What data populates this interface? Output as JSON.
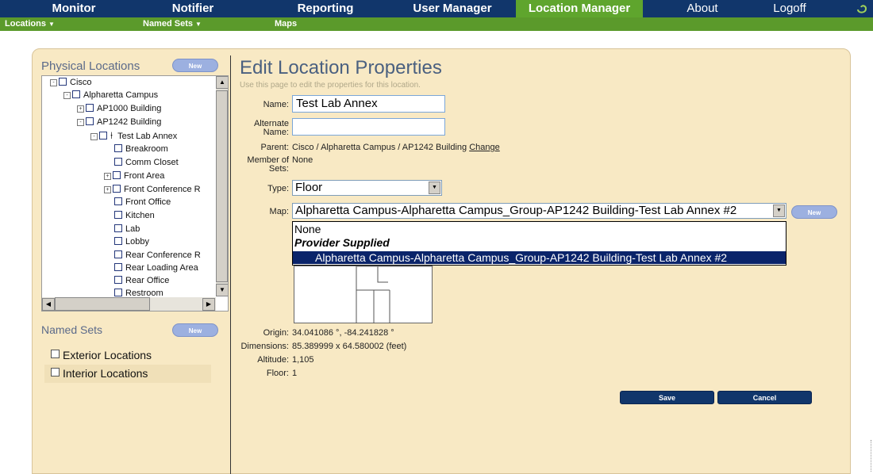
{
  "top_nav": [
    {
      "label": "Monitor"
    },
    {
      "label": "Notifier"
    },
    {
      "label": "Reporting"
    },
    {
      "label": "User Manager"
    },
    {
      "label": "Location Manager",
      "active": true
    },
    {
      "label": "About"
    },
    {
      "label": "Logoff"
    }
  ],
  "sub_nav": [
    {
      "label": "Locations",
      "dropdown": true
    },
    {
      "label": "Named Sets",
      "dropdown": true
    },
    {
      "label": "Maps",
      "dropdown": false
    }
  ],
  "sidebar": {
    "physical_title": "Physical Locations",
    "new_label": "New",
    "tree": [
      {
        "label": "Cisco",
        "expander": "-"
      },
      {
        "label": "Alpharetta Campus",
        "expander": "-"
      },
      {
        "label": "AP1000 Building",
        "expander": "+"
      },
      {
        "label": "AP1242 Building",
        "expander": "-"
      },
      {
        "label": "Test Lab Annex",
        "expander": "-",
        "icon": "location-pin-icon"
      },
      {
        "label": "Breakroom"
      },
      {
        "label": "Comm Closet"
      },
      {
        "label": "Front Area",
        "expander": "+"
      },
      {
        "label": "Front Conference R",
        "expander": "+"
      },
      {
        "label": "Front Office"
      },
      {
        "label": "Kitchen"
      },
      {
        "label": "Lab"
      },
      {
        "label": "Lobby"
      },
      {
        "label": "Rear Conference R"
      },
      {
        "label": "Rear Loading Area"
      },
      {
        "label": "Rear Office"
      },
      {
        "label": "Restroom"
      }
    ],
    "named_sets_title": "Named Sets",
    "named_sets_new_label": "New",
    "named_sets": [
      {
        "label": "Exterior Locations"
      },
      {
        "label": "Interior Locations"
      }
    ]
  },
  "main": {
    "title": "Edit Location Properties",
    "subtitle": "Use this page to edit the properties for this location.",
    "name_label": "Name:",
    "name_value": "Test Lab Annex",
    "alt_name_label_1": "Alternate",
    "alt_name_label_2": "Name:",
    "alt_name_value": "",
    "parent_label": "Parent:",
    "parent_value": "Cisco / Alpharetta Campus / AP1242 Building",
    "parent_change": "Change",
    "member_label_1": "Member of",
    "member_label_2": "Sets:",
    "member_value": "None",
    "type_label": "Type:",
    "type_value": "Floor",
    "map_label": "Map:",
    "map_value": "Alpharetta Campus-Alpharetta Campus_Group-AP1242 Building-Test Lab Annex #2",
    "map_new_label": "New",
    "map_options": [
      {
        "label": "None"
      },
      {
        "label": "Provider Supplied"
      },
      {
        "label": "Alpharetta Campus-Alpharetta Campus_Group-AP1242 Building-Test Lab Annex #2",
        "selected": true
      }
    ],
    "origin_label": "Origin:",
    "origin_value": "34.041086 °, -84.241828 °",
    "dimensions_label": "Dimensions:",
    "dimensions_value": "85.389999 x 64.580002 (feet)",
    "altitude_label": "Altitude:",
    "altitude_value": "1,105",
    "floor_label": "Floor:",
    "floor_value": "1",
    "save_label": "Save",
    "cancel_label": "Cancel"
  },
  "colors": {
    "nav_bg": "#11366b",
    "nav_active": "#5fa52d",
    "subnav_bg": "#5b9a2b",
    "panel_bg": "#f8e9c4",
    "select_highlight": "#0a246a"
  }
}
